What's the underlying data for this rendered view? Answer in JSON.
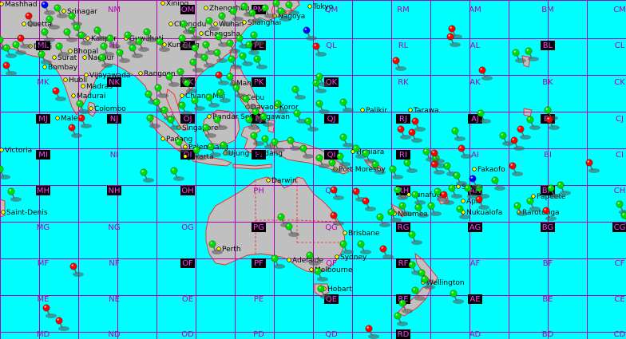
{
  "colors": {
    "ocean": "#00ffff",
    "land": "#c0c0c0",
    "grid": "#b000b0",
    "green_pin": "#00dd00",
    "red_pin": "#ff0000",
    "blue_pin": "#0000ff"
  },
  "grid_squares": [
    {
      "label": "NM",
      "highlight": false
    },
    {
      "label": "OM",
      "highlight": true
    },
    {
      "label": "PM",
      "highlight": true
    },
    {
      "label": "QM",
      "highlight": false
    },
    {
      "label": "RM",
      "highlight": false
    },
    {
      "label": "AM",
      "highlight": false
    },
    {
      "label": "BM",
      "highlight": false
    },
    {
      "label": "CM",
      "highlight": false
    },
    {
      "label": "ML",
      "highlight": true
    },
    {
      "label": "NL",
      "highlight": false
    },
    {
      "label": "OL",
      "highlight": true
    },
    {
      "label": "PL",
      "highlight": true
    },
    {
      "label": "QL",
      "highlight": false
    },
    {
      "label": "RL",
      "highlight": false
    },
    {
      "label": "AL",
      "highlight": false
    },
    {
      "label": "BL",
      "highlight": true
    },
    {
      "label": "CL",
      "highlight": false
    },
    {
      "label": "MK",
      "highlight": false
    },
    {
      "label": "NK",
      "highlight": true
    },
    {
      "label": "OK",
      "highlight": true
    },
    {
      "label": "PK",
      "highlight": true
    },
    {
      "label": "QK",
      "highlight": true
    },
    {
      "label": "RK",
      "highlight": false
    },
    {
      "label": "AK",
      "highlight": false
    },
    {
      "label": "BK",
      "highlight": false
    },
    {
      "label": "CK",
      "highlight": false
    },
    {
      "label": "MJ",
      "highlight": true
    },
    {
      "label": "NJ",
      "highlight": true
    },
    {
      "label": "OJ",
      "highlight": true
    },
    {
      "label": "PJ",
      "highlight": true
    },
    {
      "label": "QJ",
      "highlight": true
    },
    {
      "label": "RJ",
      "highlight": true
    },
    {
      "label": "AJ",
      "highlight": true
    },
    {
      "label": "BJ",
      "highlight": true
    },
    {
      "label": "CJ",
      "highlight": false
    },
    {
      "label": "MI",
      "highlight": true
    },
    {
      "label": "NI",
      "highlight": false
    },
    {
      "label": "OI",
      "highlight": true
    },
    {
      "label": "PI",
      "highlight": true
    },
    {
      "label": "QI",
      "highlight": true
    },
    {
      "label": "RI",
      "highlight": true
    },
    {
      "label": "AI",
      "highlight": false
    },
    {
      "label": "BI",
      "highlight": false
    },
    {
      "label": "CI",
      "highlight": false
    },
    {
      "label": "MH",
      "highlight": true
    },
    {
      "label": "NH",
      "highlight": true
    },
    {
      "label": "OH",
      "highlight": true
    },
    {
      "label": "PH",
      "highlight": false
    },
    {
      "label": "QH",
      "highlight": false
    },
    {
      "label": "RH",
      "highlight": true
    },
    {
      "label": "AH",
      "highlight": true
    },
    {
      "label": "BH",
      "highlight": true
    },
    {
      "label": "CH",
      "highlight": false
    },
    {
      "label": "MG",
      "highlight": false
    },
    {
      "label": "NG",
      "highlight": false
    },
    {
      "label": "OG",
      "highlight": false
    },
    {
      "label": "PG",
      "highlight": true
    },
    {
      "label": "QG",
      "highlight": false
    },
    {
      "label": "RG",
      "highlight": true
    },
    {
      "label": "AG",
      "highlight": true
    },
    {
      "label": "BG",
      "highlight": true
    },
    {
      "label": "CG",
      "highlight": true
    },
    {
      "label": "MF",
      "highlight": false
    },
    {
      "label": "NF",
      "highlight": false
    },
    {
      "label": "OF",
      "highlight": true
    },
    {
      "label": "PF",
      "highlight": true
    },
    {
      "label": "QF",
      "highlight": false
    },
    {
      "label": "RF",
      "highlight": true
    },
    {
      "label": "AF",
      "highlight": false
    },
    {
      "label": "BF",
      "highlight": false
    },
    {
      "label": "CF",
      "highlight": false
    },
    {
      "label": "ME",
      "highlight": false
    },
    {
      "label": "NE",
      "highlight": false
    },
    {
      "label": "OE",
      "highlight": false
    },
    {
      "label": "PE",
      "highlight": false
    },
    {
      "label": "QE",
      "highlight": true
    },
    {
      "label": "RE",
      "highlight": true
    },
    {
      "label": "AE",
      "highlight": true
    },
    {
      "label": "BE",
      "highlight": false
    },
    {
      "label": "CE",
      "highlight": false
    },
    {
      "label": "MD",
      "highlight": false
    },
    {
      "label": "ND",
      "highlight": false
    },
    {
      "label": "OD",
      "highlight": false
    },
    {
      "label": "PD",
      "highlight": false
    },
    {
      "label": "QD",
      "highlight": false
    },
    {
      "label": "RD",
      "highlight": true
    },
    {
      "label": "AD",
      "highlight": false
    },
    {
      "label": "BD",
      "highlight": false
    },
    {
      "label": "CD",
      "highlight": false
    }
  ],
  "cities": [
    "Mashhad",
    "Srinagar",
    "Quetta",
    "Xining",
    "Zhengzhou",
    "Tokyo",
    "Nagoya",
    "Shanghai",
    "Chengdu",
    "Wuhan",
    "Changsha",
    "Kunming",
    "Kanpur",
    "Guwahati",
    "Delhi",
    "Bhopal",
    "Nagpur",
    "Surat",
    "Bombay",
    "Hubli",
    "Vijayawada",
    "Madras",
    "Madurai",
    "Colombo",
    "Male",
    "Rangoon",
    "Chiang Mai",
    "Manila",
    "Cebu",
    "Davao",
    "Koror",
    "Bandar Seri Begawan",
    "Singapore",
    "Padang",
    "Palembang",
    "Jakarta",
    "Ujung Pandang",
    "Port Moresby",
    "Darwin",
    "Perth",
    "Adelaide",
    "Melbourne",
    "Sydney",
    "Brisbane",
    "Hobart",
    "Wellington",
    "Noumea",
    "Nukualofa",
    "Suva",
    "Rarotonga",
    "Papeete",
    "Palikir",
    "Tarawa",
    "Funafuti",
    "Fakaofo",
    "Apia",
    "Honiara",
    "Saint-Denis",
    "Victoria"
  ],
  "markers": {
    "green": 150,
    "red": 35,
    "blue": 3
  }
}
